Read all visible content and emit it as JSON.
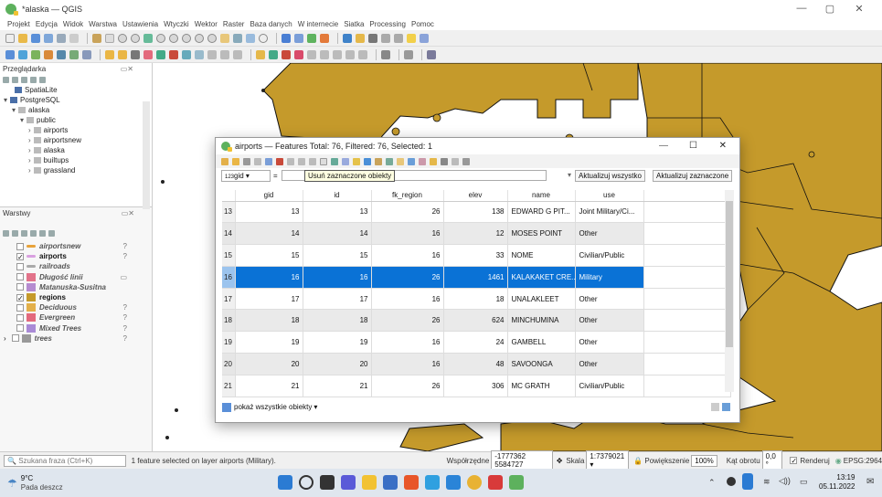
{
  "window": {
    "title": "*alaska — QGIS"
  },
  "menu": [
    "Projekt",
    "Edycja",
    "Widok",
    "Warstwa",
    "Ustawienia",
    "Wtyczki",
    "Wektor",
    "Raster",
    "Baza danych",
    "W internecie",
    "Siatka",
    "Processing",
    "Pomoc"
  ],
  "browser": {
    "title": "Przeglądarka",
    "items": [
      {
        "label": "SpatiaLite",
        "indent": 1
      },
      {
        "label": "PostgreSQL",
        "indent": 0,
        "prefix": "▾"
      },
      {
        "label": "alaska",
        "indent": 1,
        "prefix": "▾"
      },
      {
        "label": "public",
        "indent": 2,
        "prefix": "▾"
      },
      {
        "label": "airports",
        "indent": 3,
        "prefix": "›"
      },
      {
        "label": "airportsnew",
        "indent": 3,
        "prefix": "›"
      },
      {
        "label": "alaska",
        "indent": 3,
        "prefix": "›"
      },
      {
        "label": "builtups",
        "indent": 3,
        "prefix": "›"
      },
      {
        "label": "grassland",
        "indent": 3,
        "prefix": "›"
      }
    ]
  },
  "layers": {
    "title": "Warstwy",
    "items": [
      {
        "label": "airportsnew",
        "checked": false,
        "color": "#e8a23a",
        "style": "ital",
        "badge": "?"
      },
      {
        "label": "airports",
        "checked": true,
        "color": "#d9a0e0",
        "style": "bold",
        "badge": "?"
      },
      {
        "label": "railroads",
        "checked": false,
        "color": "#aaaaaa",
        "style": "ital",
        "badge": ""
      },
      {
        "label": "Długość linii",
        "checked": false,
        "color": "#e2738a",
        "style": "ital",
        "badge": "▭"
      },
      {
        "label": "Matanuska-Susitna",
        "checked": false,
        "color": "#b58bd0",
        "style": "ital",
        "badge": ""
      },
      {
        "label": "regions",
        "checked": true,
        "color": "#c59a2b",
        "style": "bold",
        "badge": ""
      },
      {
        "label": "Deciduous",
        "checked": false,
        "color": "#e3b04a",
        "style": "ital",
        "badge": "?"
      },
      {
        "label": "Evergreen",
        "checked": false,
        "color": "#e36a7d",
        "style": "ital",
        "badge": "?"
      },
      {
        "label": "Mixed Trees",
        "checked": false,
        "color": "#a98ad6",
        "style": "ital",
        "badge": "?"
      },
      {
        "label": "trees",
        "checked": false,
        "color": "#999999",
        "style": "ital",
        "badge": "?"
      }
    ]
  },
  "dialog": {
    "title": "airports — Features Total: 76, Filtered: 76, Selected: 1",
    "field_select": "gid",
    "tooltip": "Usuń zaznaczone obiekty",
    "update_all": "Aktualizuj wszystko",
    "update_selected": "Aktualizuj zaznaczone",
    "columns": [
      "gid",
      "id",
      "fk_region",
      "elev",
      "name",
      "use"
    ],
    "rows": [
      {
        "idx": "13",
        "gid": "13",
        "id": "13",
        "fk_region": "26",
        "elev": "138",
        "name": "EDWARD G PIT...",
        "use": "Joint Military/Ci...",
        "sel": false
      },
      {
        "idx": "14",
        "gid": "14",
        "id": "14",
        "fk_region": "16",
        "elev": "12",
        "name": "MOSES POINT",
        "use": "Other",
        "sel": false
      },
      {
        "idx": "15",
        "gid": "15",
        "id": "15",
        "fk_region": "16",
        "elev": "33",
        "name": "NOME",
        "use": "Civilian/Public",
        "sel": false
      },
      {
        "idx": "16",
        "gid": "16",
        "id": "16",
        "fk_region": "26",
        "elev": "1461",
        "name": "KALAKAKET CRE...",
        "use": "Military",
        "sel": true
      },
      {
        "idx": "17",
        "gid": "17",
        "id": "17",
        "fk_region": "16",
        "elev": "18",
        "name": "UNALAKLEET",
        "use": "Other",
        "sel": false
      },
      {
        "idx": "18",
        "gid": "18",
        "id": "18",
        "fk_region": "26",
        "elev": "624",
        "name": "MINCHUMINA",
        "use": "Other",
        "sel": false
      },
      {
        "idx": "19",
        "gid": "19",
        "id": "19",
        "fk_region": "16",
        "elev": "24",
        "name": "GAMBELL",
        "use": "Other",
        "sel": false
      },
      {
        "idx": "20",
        "gid": "20",
        "id": "20",
        "fk_region": "16",
        "elev": "48",
        "name": "SAVOONGA",
        "use": "Other",
        "sel": false
      },
      {
        "idx": "21",
        "gid": "21",
        "id": "21",
        "fk_region": "26",
        "elev": "306",
        "name": "MC GRATH",
        "use": "Civilian/Public",
        "sel": false
      }
    ],
    "footer": "pokaż wszystkie obiekty"
  },
  "status": {
    "search_placeholder": "Szukana fraza (Ctrl+K)",
    "message": "1 feature selected on layer airports (Military).",
    "coord_label": "Współrzędne",
    "coord_value": "-1777362 5584727",
    "scale_label": "Skala",
    "scale_value": "1:7379021",
    "zoom_label": "Powiększenie",
    "zoom_value": "100%",
    "rotation_label": "Kąt obrotu",
    "rotation_value": "0,0 °",
    "render": "Renderuj",
    "crs": "EPSG:2964"
  },
  "taskbar": {
    "temp": "9°C",
    "weather": "Pada deszcz",
    "time": "13:19",
    "date": "05.11.2022"
  },
  "colors": {
    "accent": "#0a72d6",
    "region": "#c59a2b",
    "toolbar": "#f0f0f0"
  }
}
